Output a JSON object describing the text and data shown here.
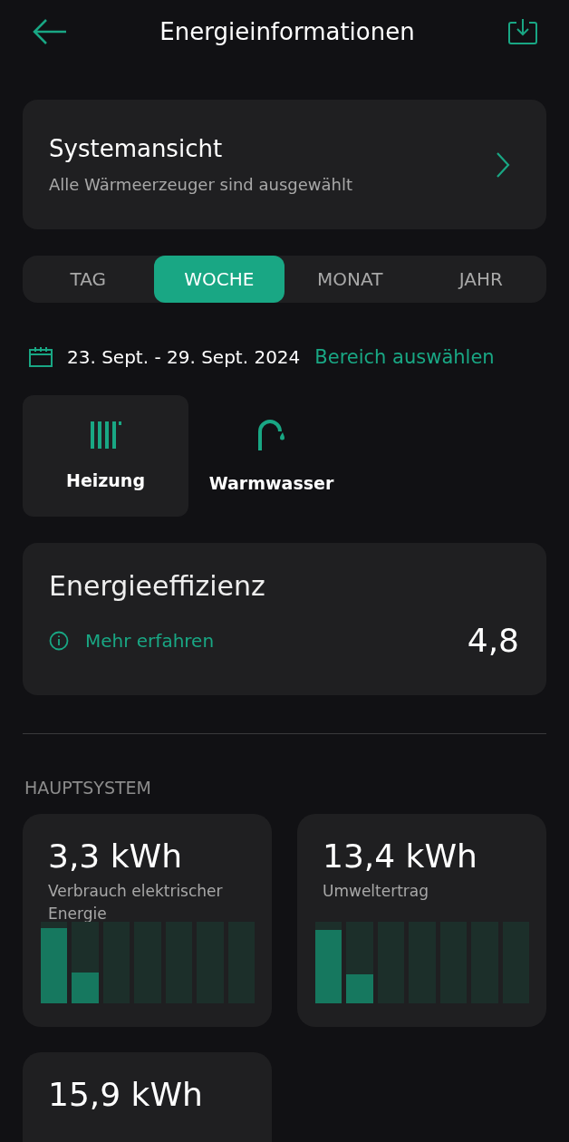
{
  "header": {
    "title": "Energieinformationen"
  },
  "system_view": {
    "title": "Systemansicht",
    "subtitle": "Alle Wärmeerzeuger sind ausgewählt"
  },
  "tabs": [
    {
      "label": "TAG",
      "selected": false
    },
    {
      "label": "WOCHE",
      "selected": true
    },
    {
      "label": "MONAT",
      "selected": false
    },
    {
      "label": "JAHR",
      "selected": false
    }
  ],
  "date_range": {
    "text": "23. Sept. - 29. Sept. 2024",
    "action": "Bereich auswählen"
  },
  "categories": [
    {
      "kind": "heating",
      "label": "Heizung",
      "selected": true
    },
    {
      "kind": "water",
      "label": "Warmwasser",
      "selected": false
    }
  ],
  "efficiency": {
    "title": "Energieeffizienz",
    "link": "Mehr erfahren",
    "value": "4,8"
  },
  "section": {
    "title": "HAUPTSYSTEM"
  },
  "metrics": [
    {
      "value": "3,3 kWh",
      "label": "Verbrauch elektrischer Energie",
      "bars": [
        {
          "level": 0.92
        },
        {
          "level": 0.38
        }
      ]
    },
    {
      "value": "13,4 kWh",
      "label": "Umweltertrag",
      "bars": [
        {
          "level": 0.9
        },
        {
          "level": 0.36
        }
      ]
    },
    {
      "value": "15,9 kWh"
    }
  ]
}
